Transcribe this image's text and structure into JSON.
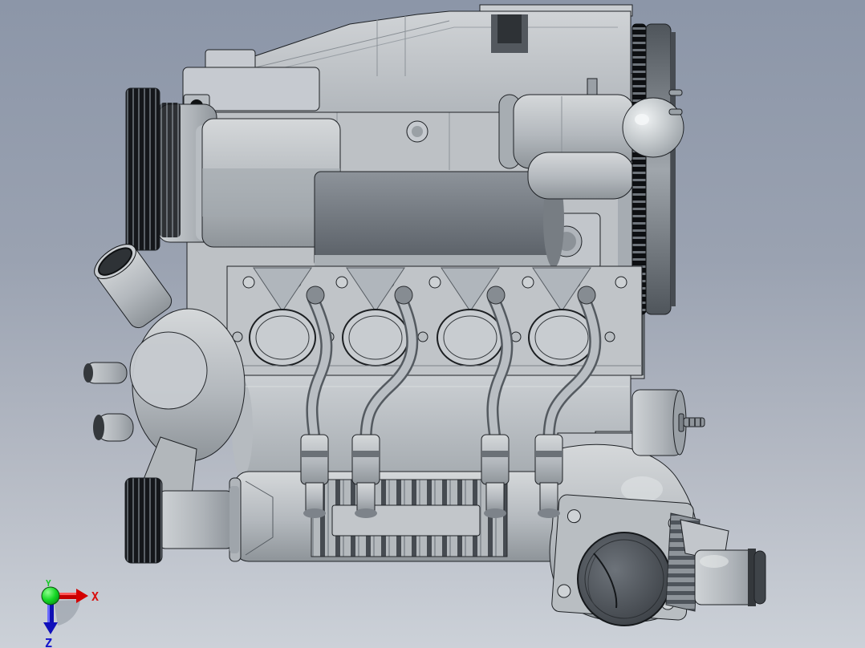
{
  "app": {
    "name": "cad-viewport",
    "description": "3D CAD viewport showing a side view of a supercharged V8 engine assembly, oriented upside-down (oil pan at top, roots supercharger and throttle body at bottom)"
  },
  "viewport": {
    "background_top_color": "#8c96a8",
    "background_bottom_color": "#ccd1d8",
    "model_finish_color": "#c3c7cb",
    "edge_line_color": "#1e2125"
  },
  "model": {
    "name": "V8 engine with roots supercharger",
    "parts": [
      "oil-pan",
      "engine-block",
      "front-bracket",
      "ac-compressor",
      "accessory-ribbed-pulley",
      "starter-motor",
      "starter-solenoid",
      "flywheel-ring-gear",
      "flywheel-dome",
      "cylinder-head",
      "exhaust-ports",
      "head-bolt-bosses",
      "spark-plug-wires",
      "ignition-coils",
      "valve-cover",
      "supercharger-body",
      "intercooler-fins",
      "supercharger-snout",
      "supercharger-drive-shaft",
      "crank-pulley",
      "water-pump",
      "water-inlet-pipe",
      "hose-fittings",
      "intake-elbow",
      "throttle-body",
      "throttle-bore",
      "clamp-ring",
      "coolant-outlet",
      "vacuum-canister",
      "hose-barb"
    ]
  },
  "triad": {
    "x_label": "X",
    "y_label": "Y",
    "z_label": "Z",
    "x_color": "#d90f0f",
    "y_color": "#16c926",
    "z_color": "#1414cc",
    "origin_color": "#1ddd2f",
    "shadow_color": "#8a919c"
  }
}
